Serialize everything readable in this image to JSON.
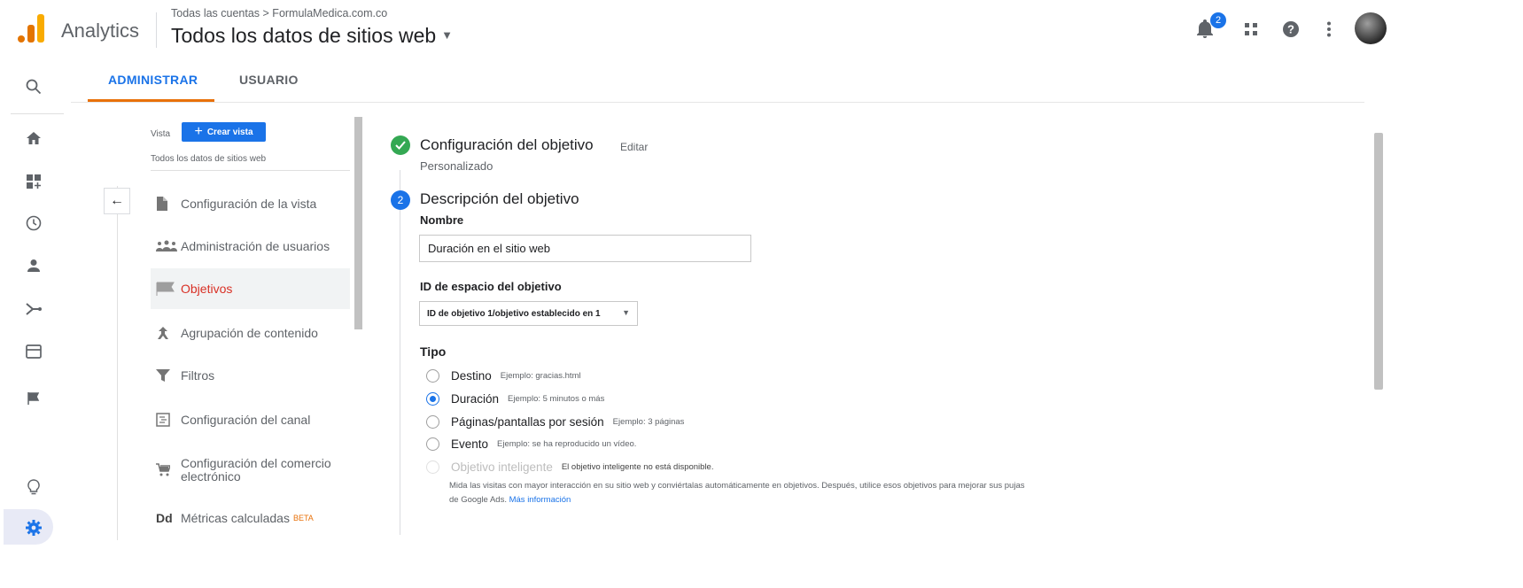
{
  "header": {
    "app_name": "Analytics",
    "breadcrumb": "Todas las cuentas > FormulaMedica.com.co",
    "property_title": "Todos los datos de sitios web",
    "notification_count": "2",
    "brand_colors": {
      "logo_orange": "#f9ab00",
      "logo_dark": "#e37400",
      "accent_blue": "#1a73e8",
      "active_tab_orange": "#e8710a"
    }
  },
  "rail": {
    "icons": [
      "search-icon",
      "home-icon",
      "customization-icon",
      "realtime-clock-icon",
      "audience-person-icon",
      "acquisition-icon",
      "behavior-icon",
      "conversions-flag-icon",
      "discover-lightbulb-icon",
      "admin-gear-icon"
    ]
  },
  "tabs": [
    {
      "label": "ADMINISTRAR",
      "active": true
    },
    {
      "label": "USUARIO",
      "active": false
    }
  ],
  "nav": {
    "view_label": "Vista",
    "create_view_label": "Crear vista",
    "view_name": "Todos los datos de sitios web",
    "items": [
      {
        "label": "Configuración de la vista",
        "icon": "document-icon",
        "active": false
      },
      {
        "label": "Administración de usuarios",
        "icon": "users-icon",
        "active": false
      },
      {
        "label": "Objetivos",
        "icon": "flag-icon",
        "active": true
      },
      {
        "label": "Agrupación de contenido",
        "icon": "content-grouping-icon",
        "active": false
      },
      {
        "label": "Filtros",
        "icon": "filter-icon",
        "active": false
      },
      {
        "label": "Configuración del canal",
        "icon": "channel-icon",
        "active": false
      },
      {
        "label": "Configuración del comercio electrónico",
        "icon": "cart-icon",
        "active": false
      },
      {
        "label": "Métricas calculadas",
        "icon": "dd-icon",
        "badge": "BETA",
        "active": false
      }
    ],
    "calc_metrics_icon_text": "Dd"
  },
  "main": {
    "step1": {
      "title": "Configuración del objetivo",
      "edit_label": "Editar",
      "summary": "Personalizado"
    },
    "step2": {
      "number": "2",
      "title": "Descripción del objetivo",
      "name_label": "Nombre",
      "name_value": "Duración en el sitio web",
      "slot_label": "ID de espacio del objetivo",
      "slot_value": "ID de objetivo 1/objetivo establecido en 1",
      "type_label": "Tipo",
      "types": [
        {
          "label": "Destino",
          "example": "Ejemplo: gracias.html",
          "selected": false,
          "disabled": false
        },
        {
          "label": "Duración",
          "example": "Ejemplo: 5 minutos o más",
          "selected": true,
          "disabled": false
        },
        {
          "label": "Páginas/pantallas por sesión",
          "example": "Ejemplo: 3 páginas",
          "selected": false,
          "disabled": false
        },
        {
          "label": "Evento",
          "example": "Ejemplo: se ha reproducido un vídeo.",
          "selected": false,
          "disabled": false
        },
        {
          "label": "Objetivo inteligente",
          "example": "El objetivo inteligente no está disponible.",
          "selected": false,
          "disabled": true
        }
      ],
      "smart_goal_desc": "Mida las visitas con mayor interacción en su sitio web y conviértalas automáticamente en objetivos. Después, utilice esos objetivos para mejorar sus pujas de Google Ads.",
      "more_info_link": "Más información"
    }
  }
}
